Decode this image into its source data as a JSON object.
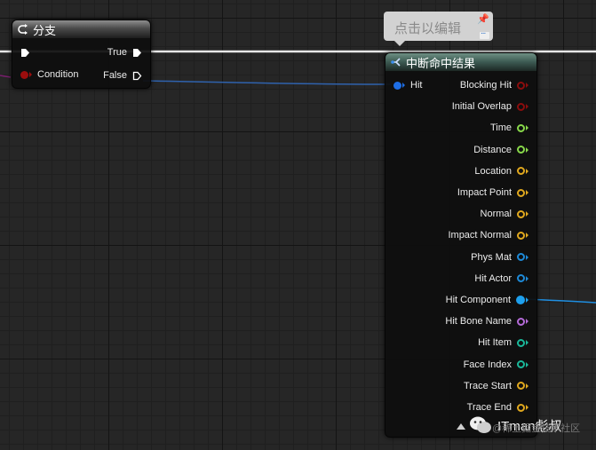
{
  "branch_node": {
    "title": "分支",
    "condition_label": "Condition",
    "true_label": "True",
    "false_label": "False",
    "condition_color": "#9b0d0d"
  },
  "comment": {
    "text": "点击以编辑"
  },
  "break_hit_node": {
    "title": "中断命中结果",
    "hit_label": "Hit",
    "hit_color": "#1e6ee6",
    "outputs": [
      {
        "label": "Blocking Hit",
        "color": "#8b0d0d",
        "type": "circle"
      },
      {
        "label": "Initial Overlap",
        "color": "#8b0d0d",
        "type": "circle"
      },
      {
        "label": "Time",
        "color": "#88d84a",
        "type": "circle"
      },
      {
        "label": "Distance",
        "color": "#88d84a",
        "type": "circle"
      },
      {
        "label": "Location",
        "color": "#e0a81e",
        "type": "circle"
      },
      {
        "label": "Impact Point",
        "color": "#e0a81e",
        "type": "circle"
      },
      {
        "label": "Normal",
        "color": "#e0a81e",
        "type": "circle"
      },
      {
        "label": "Impact Normal",
        "color": "#e0a81e",
        "type": "circle"
      },
      {
        "label": "Phys Mat",
        "color": "#1e8ad8",
        "type": "circle"
      },
      {
        "label": "Hit Actor",
        "color": "#1e8ad8",
        "type": "circle"
      },
      {
        "label": "Hit Component",
        "color": "#1ea0ee",
        "type": "filled"
      },
      {
        "label": "Hit Bone Name",
        "color": "#b46ad8",
        "type": "circle"
      },
      {
        "label": "Hit Item",
        "color": "#1ab89a",
        "type": "circle"
      },
      {
        "label": "Face Index",
        "color": "#1ab89a",
        "type": "circle"
      },
      {
        "label": "Trace Start",
        "color": "#e0a81e",
        "type": "circle"
      },
      {
        "label": "Trace End",
        "color": "#e0a81e",
        "type": "circle"
      }
    ]
  },
  "watermark": {
    "text": "ITman彪叔",
    "sub": "@稀土掘金技术社区"
  }
}
